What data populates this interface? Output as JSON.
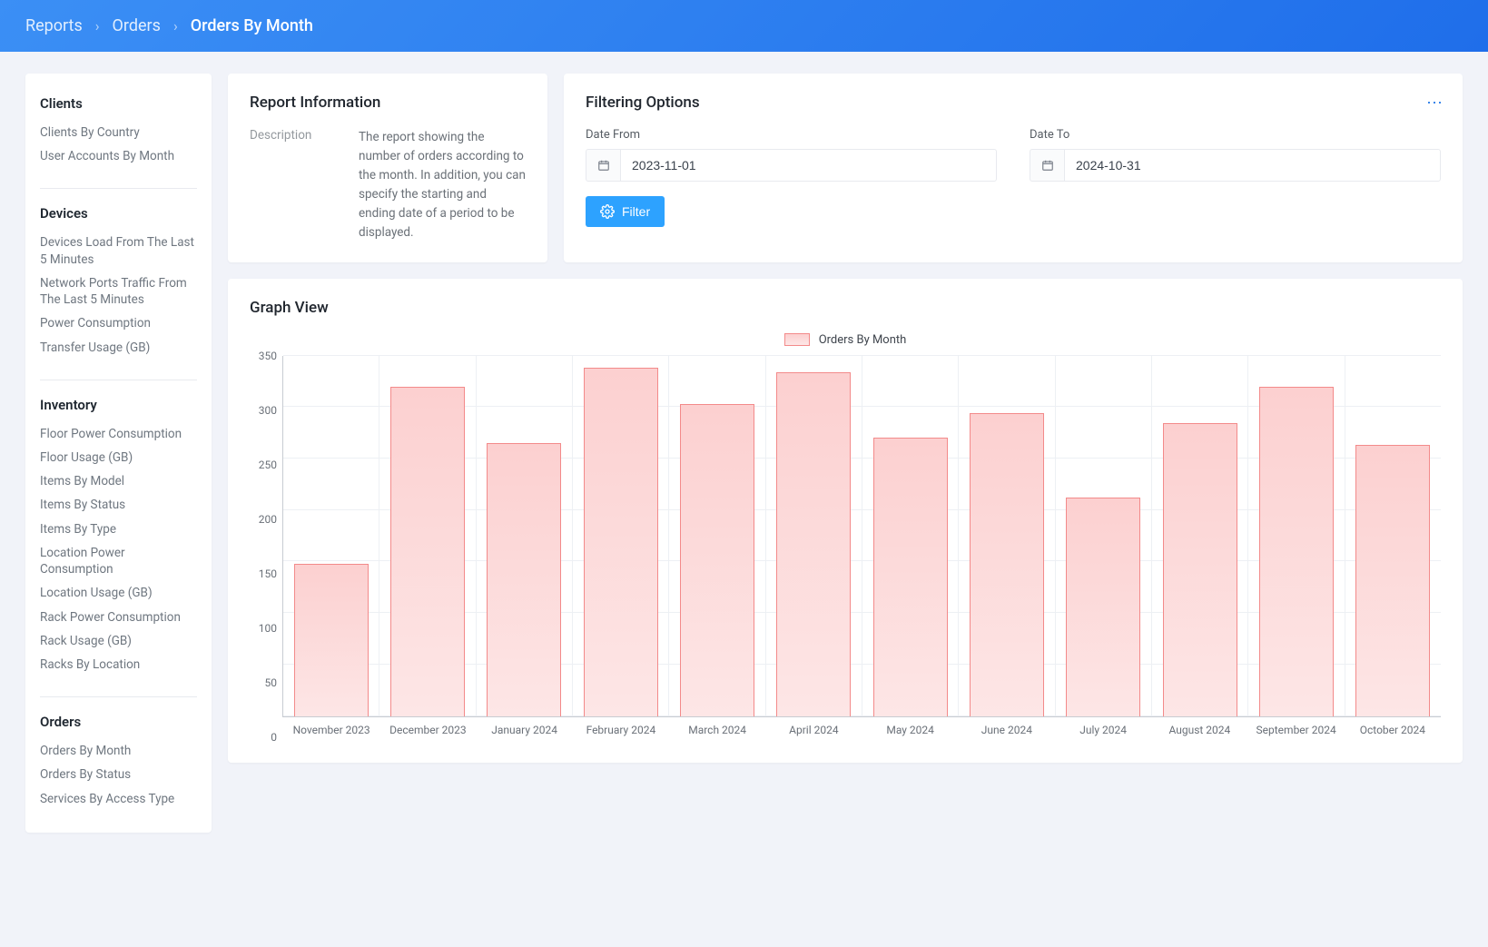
{
  "breadcrumbs": [
    {
      "label": "Reports",
      "current": false
    },
    {
      "label": "Orders",
      "current": false
    },
    {
      "label": "Orders By Month",
      "current": true
    }
  ],
  "sidebar": [
    {
      "title": "Clients",
      "items": [
        "Clients By Country",
        "User Accounts By Month"
      ]
    },
    {
      "title": "Devices",
      "items": [
        "Devices Load From The Last 5 Minutes",
        "Network Ports Traffic From The Last 5 Minutes",
        "Power Consumption",
        "Transfer Usage (GB)"
      ]
    },
    {
      "title": "Inventory",
      "items": [
        "Floor Power Consumption",
        "Floor Usage (GB)",
        "Items By Model",
        "Items By Status",
        "Items By Type",
        "Location Power Consumption",
        "Location Usage (GB)",
        "Rack Power Consumption",
        "Rack Usage (GB)",
        "Racks By Location"
      ]
    },
    {
      "title": "Orders",
      "items": [
        "Orders By Month",
        "Orders By Status",
        "Services By Access Type"
      ]
    }
  ],
  "report_info": {
    "header": "Report Information",
    "description_label": "Description",
    "description": "The report showing the number of orders according to the month. In addition, you can specify the starting and ending date of a period to be displayed."
  },
  "filters": {
    "header": "Filtering Options",
    "date_from_label": "Date From",
    "date_from_value": "2023-11-01",
    "date_to_label": "Date To",
    "date_to_value": "2024-10-31",
    "filter_button": "Filter"
  },
  "graph": {
    "header": "Graph View",
    "legend": "Orders By Month"
  },
  "chart_data": {
    "type": "bar",
    "title": "Orders By Month",
    "xlabel": "",
    "ylabel": "",
    "ylim": [
      0,
      350
    ],
    "yticks": [
      0,
      50,
      100,
      150,
      200,
      250,
      300,
      350
    ],
    "categories": [
      "November 2023",
      "December 2023",
      "January 2024",
      "February 2024",
      "March 2024",
      "April 2024",
      "May 2024",
      "June 2024",
      "July 2024",
      "August 2024",
      "September 2024",
      "October 2024"
    ],
    "values": [
      148,
      320,
      265,
      338,
      303,
      334,
      270,
      294,
      212,
      284,
      320,
      263
    ]
  }
}
